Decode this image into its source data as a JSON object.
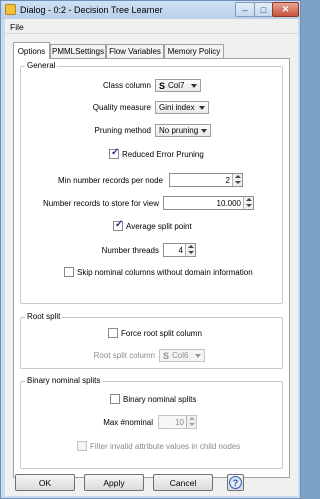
{
  "window": {
    "title": "Dialog - 0:2 - Decision Tree Learner",
    "controls": {
      "minimize": "–",
      "maximize": "□",
      "close": "✕"
    }
  },
  "menu": {
    "file": "File"
  },
  "tabs": [
    {
      "label": "Options"
    },
    {
      "label": "PMMLSettings"
    },
    {
      "label": "Flow Variables"
    },
    {
      "label": "Memory Policy"
    }
  ],
  "general": {
    "title": "General",
    "class_column": {
      "label": "Class column",
      "icon": "S",
      "value": "Col7"
    },
    "quality_measure": {
      "label": "Quality measure",
      "value": "Gini index"
    },
    "pruning_method": {
      "label": "Pruning method",
      "value": "No pruning"
    },
    "reduced_error_pruning": {
      "label": "Reduced Error Pruning",
      "checked": true
    },
    "min_records": {
      "label": "Min number records per node",
      "value": "2"
    },
    "records_for_view": {
      "label": "Number records to store for view",
      "value": "10.000"
    },
    "average_split_point": {
      "label": "Average split point",
      "checked": true
    },
    "threads": {
      "label": "Number threads",
      "value": "4"
    },
    "skip_nominal": {
      "label": "Skip nominal columns without domain information",
      "checked": false
    }
  },
  "root_split": {
    "title": "Root split",
    "force_root": {
      "label": "Force root split column",
      "checked": false
    },
    "root_column": {
      "label": "Root split column",
      "icon": "S",
      "value": "Col6"
    }
  },
  "binary_nominal": {
    "title": "Binary nominal splits",
    "binary_splits": {
      "label": "Binary nominal splits",
      "checked": false
    },
    "max_nominal": {
      "label": "Max #nominal",
      "value": "10"
    },
    "filter_invalid": {
      "label": "Filter invalid attribute values in child nodes",
      "checked": false
    }
  },
  "footer": {
    "ok": "OK",
    "apply": "Apply",
    "cancel": "Cancel",
    "help": "?"
  }
}
